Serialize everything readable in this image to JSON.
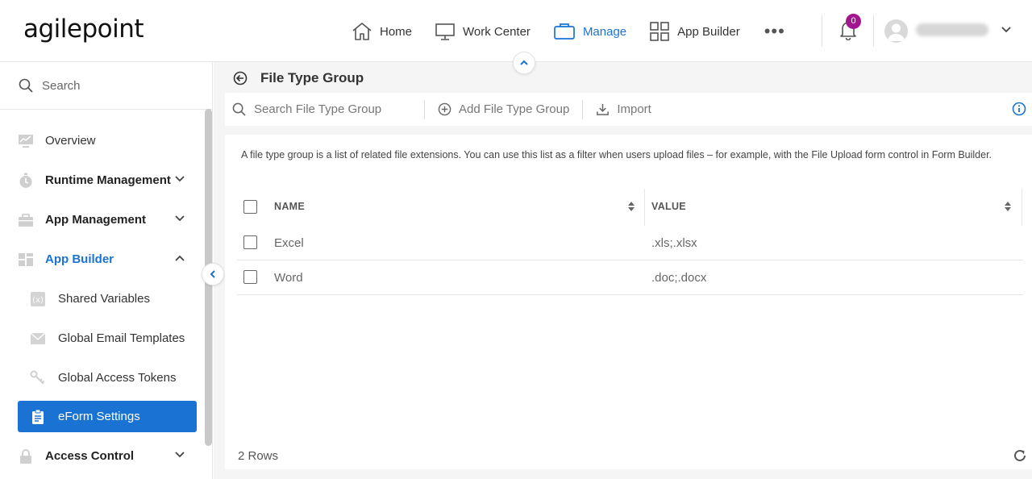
{
  "header": {
    "logo": "agilepoint",
    "nav": [
      {
        "label": "Home",
        "icon": "home-icon"
      },
      {
        "label": "Work Center",
        "icon": "monitor-icon"
      },
      {
        "label": "Manage",
        "icon": "briefcase-icon",
        "active": true
      },
      {
        "label": "App Builder",
        "icon": "grid-icon"
      }
    ],
    "more": "•••",
    "notifications_count": "0",
    "user_name": "username"
  },
  "sidebar": {
    "search_label": "Search",
    "items": [
      {
        "label": "Overview",
        "icon": "chart-monitor-icon"
      },
      {
        "label": "Runtime Management",
        "icon": "stopwatch-icon"
      },
      {
        "label": "App Management",
        "icon": "toolbox-icon"
      },
      {
        "label": "App Builder",
        "icon": "dashboard-icon"
      },
      {
        "label": "Shared Variables",
        "icon": "variable-icon"
      },
      {
        "label": "Global Email Templates",
        "icon": "envelope-icon"
      },
      {
        "label": "Global Access Tokens",
        "icon": "keys-icon"
      },
      {
        "label": "eForm Settings",
        "icon": "clipboard-icon"
      },
      {
        "label": "Access Control",
        "icon": "lock-icon"
      }
    ]
  },
  "main": {
    "title": "File Type Group",
    "toolbar": {
      "search_placeholder": "Search File Type Group",
      "add_label": "Add File Type Group",
      "import_label": "Import"
    },
    "description": "A file type group is a list of related file extensions. You can use this list as a filter when users upload files – for example, with the File Upload form control in Form Builder.",
    "table": {
      "columns": [
        "NAME",
        "VALUE"
      ],
      "rows": [
        {
          "name": "Excel",
          "value": ".xls;.xlsx"
        },
        {
          "name": "Word",
          "value": ".doc;.docx"
        }
      ]
    },
    "row_count": "2 Rows"
  },
  "colors": {
    "accent": "#1a73d2",
    "badge": "#a4168f"
  }
}
